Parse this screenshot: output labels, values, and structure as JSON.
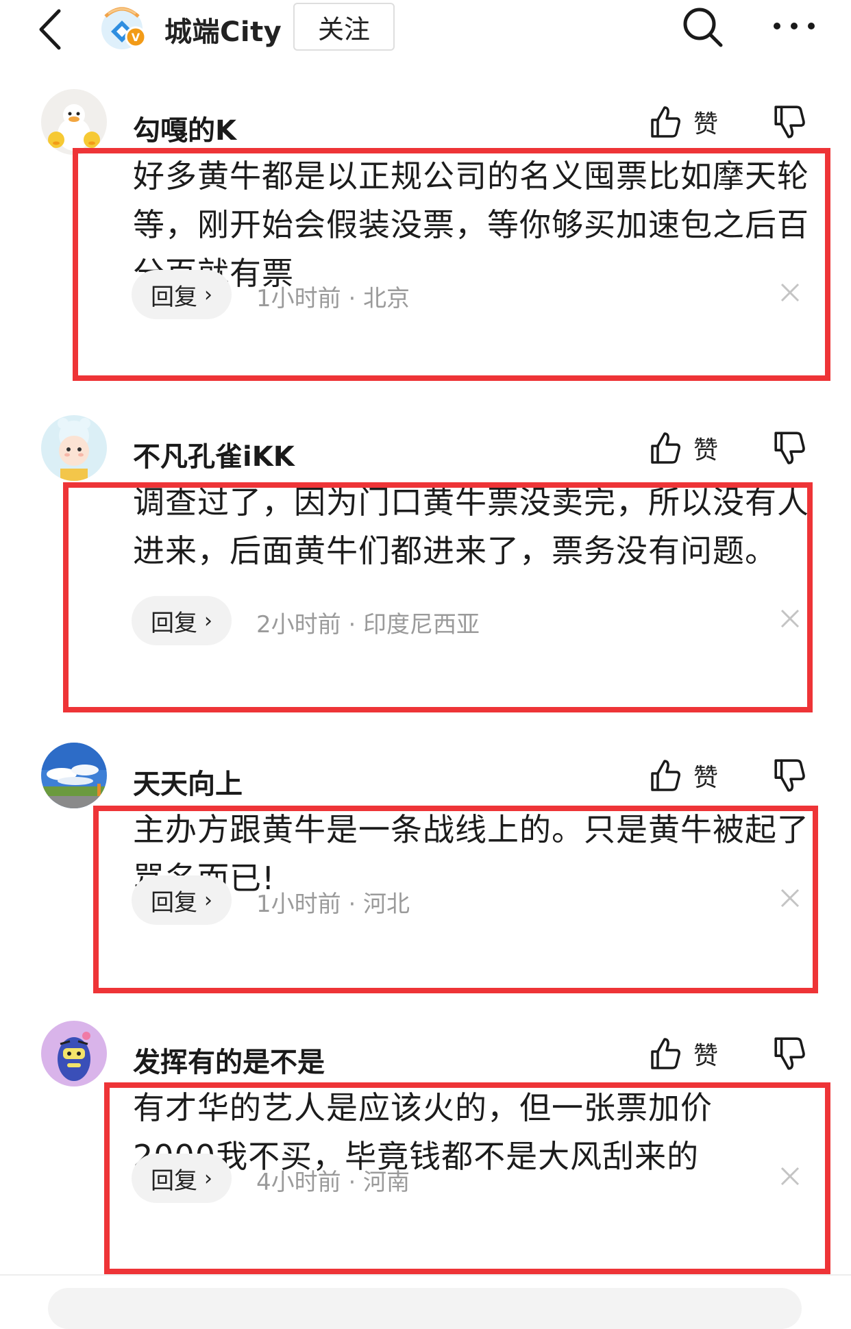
{
  "header": {
    "account_name": "城端City",
    "follow_label": "关注",
    "icons": [
      "back-arrow-icon",
      "verified-badge-icon",
      "search-icon",
      "more-dots-icon"
    ]
  },
  "comments": [
    {
      "user": "勾嘎的K",
      "text": "好多黄牛都是以正规公司的名义囤票比如摩天轮等，刚开始会假装没票，等你够买加速包之后百分百就有票",
      "reply_label": "回复",
      "time_location": "1小时前 · 北京",
      "like_label": "赞"
    },
    {
      "user": "不凡孔雀iKK",
      "text": "调查过了，因为门口黄牛票没卖完，所以没有人进来，后面黄牛们都进来了，票务没有问题。",
      "reply_label": "回复",
      "time_location": "2小时前 · 印度尼西亚",
      "like_label": "赞"
    },
    {
      "user": "天天向上",
      "text": "主办方跟黄牛是一条战线上的。只是黄牛被起了骂名而已!",
      "reply_label": "回复",
      "time_location": "1小时前 · 河北",
      "like_label": "赞"
    },
    {
      "user": "发挥有的是不是",
      "text": "有才华的艺人是应该火的，但一张票加价2000我不买，毕竟钱都不是大风刮来的",
      "reply_label": "回复",
      "time_location": "4小时前 · 河南",
      "like_label": "赞"
    }
  ],
  "colors": {
    "highlight_border": "#ee3437",
    "meta_text": "#9a9a9a",
    "reply_bg": "#f2f2f2",
    "logo_blue": "#2f8ee0",
    "logo_orange": "#f29b18"
  }
}
